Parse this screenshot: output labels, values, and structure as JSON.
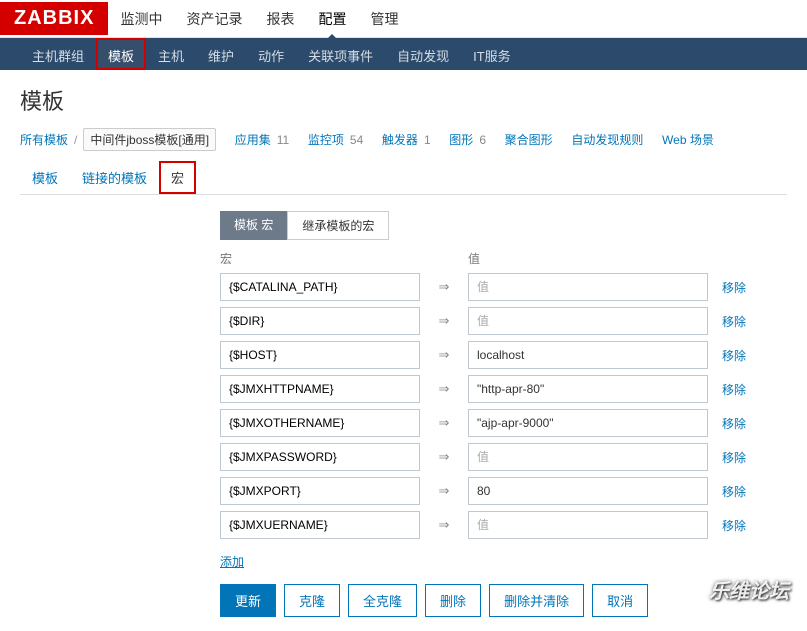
{
  "logo": "ZABBIX",
  "topnav": {
    "monitoring": "监测中",
    "inventory": "资产记录",
    "reports": "报表",
    "config": "配置",
    "admin": "管理"
  },
  "subnav": {
    "hostgroups": "主机群组",
    "templates": "模板",
    "hosts": "主机",
    "maintenance": "维护",
    "actions": "动作",
    "correlation": "关联项事件",
    "discovery": "自动发现",
    "itservices": "IT服务"
  },
  "page_title": "模板",
  "crumbs": {
    "all_templates": "所有模板",
    "current": "中间件jboss模板[通用]",
    "apps": {
      "label": "应用集",
      "count": "11"
    },
    "items": {
      "label": "监控项",
      "count": "54"
    },
    "triggers": {
      "label": "触发器",
      "count": "1"
    },
    "graphs": {
      "label": "图形",
      "count": "6"
    },
    "screens": {
      "label": "聚合图形",
      "count": ""
    },
    "drules": {
      "label": "自动发现规则",
      "count": ""
    },
    "web": {
      "label": "Web 场景",
      "count": ""
    }
  },
  "tabs": {
    "template": "模板",
    "linked": "链接的模板",
    "macros": "宏"
  },
  "toggle": {
    "template_macros": "模板 宏",
    "inherited": "继承模板的宏"
  },
  "cols": {
    "macro": "宏",
    "value": "值"
  },
  "arrow": "⇒",
  "placeholder_value": "值",
  "remove_label": "移除",
  "add_label": "添加",
  "macros": [
    {
      "name": "{$CATALINA_PATH}",
      "value": ""
    },
    {
      "name": "{$DIR}",
      "value": ""
    },
    {
      "name": "{$HOST}",
      "value": "localhost"
    },
    {
      "name": "{$JMXHTTPNAME}",
      "value": "\"http-apr-80\""
    },
    {
      "name": "{$JMXOTHERNAME}",
      "value": "\"ajp-apr-9000\""
    },
    {
      "name": "{$JMXPASSWORD}",
      "value": ""
    },
    {
      "name": "{$JMXPORT}",
      "value": "80"
    },
    {
      "name": "{$JMXUERNAME}",
      "value": ""
    }
  ],
  "buttons": {
    "update": "更新",
    "clone": "克隆",
    "full_clone": "全克隆",
    "delete": "删除",
    "delete_clear": "删除并清除",
    "cancel": "取消"
  },
  "watermark": "乐维论坛"
}
